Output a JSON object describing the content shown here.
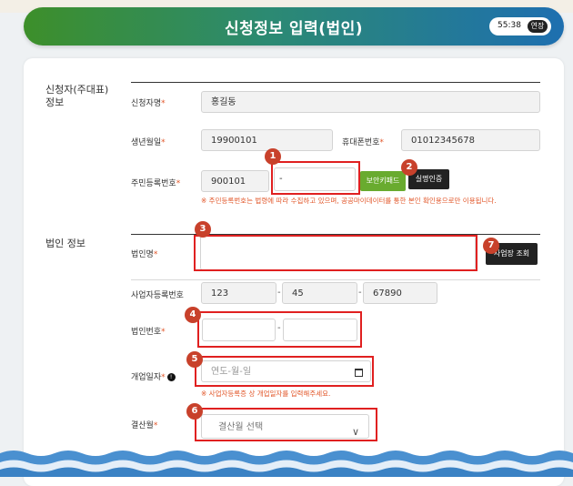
{
  "header": {
    "title": "신청정보 입력(법인)",
    "timer": "55:38",
    "extend_label": "연장"
  },
  "applicant": {
    "section_title": "신청자(주대표)\n정보",
    "name_label": "신청자명",
    "name_value": "홍길동",
    "birth_label": "생년월일",
    "birth_value": "19900101",
    "phone_label": "휴대폰번호",
    "phone_value": "01012345678",
    "rrn_label": "주민등록번호",
    "rrn_front": "900101",
    "rrn_dash": "-",
    "keypad_button": "보안키패드",
    "verify_button": "실명인증",
    "note": "※ 주민등록번호는 법령에 따라 수집하고 있으며, 공공마이데이터를 통한 본인 확인용으로만 이용됩니다."
  },
  "corp": {
    "section_title": "법인 정보",
    "name_label": "법인명",
    "lookup_button": "사업장 조회",
    "bizno_label": "사업자등록번호",
    "bizno": [
      "123",
      "45",
      "67890"
    ],
    "bizno_dash": "-",
    "corpno_label": "법인번호",
    "corpno_dash": "-",
    "open_label": "개업일자",
    "open_info": "!",
    "open_placeholder": "연도-월-일",
    "open_note": "※ 사업자등록증 상 개업일자를 입력해주세요.",
    "settle_label": "결산월",
    "settle_placeholder": "결산월 선택",
    "settle_chevron": "∨"
  },
  "required_mark": "*",
  "badges": [
    "1",
    "2",
    "3",
    "4",
    "5",
    "6",
    "7"
  ],
  "colors": {
    "header_start": "#3d8f2a",
    "header_end": "#1e6fb0",
    "required": "#e2572a",
    "highlight": "#e02020",
    "badge": "#c8412b",
    "green_button": "#69ab2f"
  }
}
